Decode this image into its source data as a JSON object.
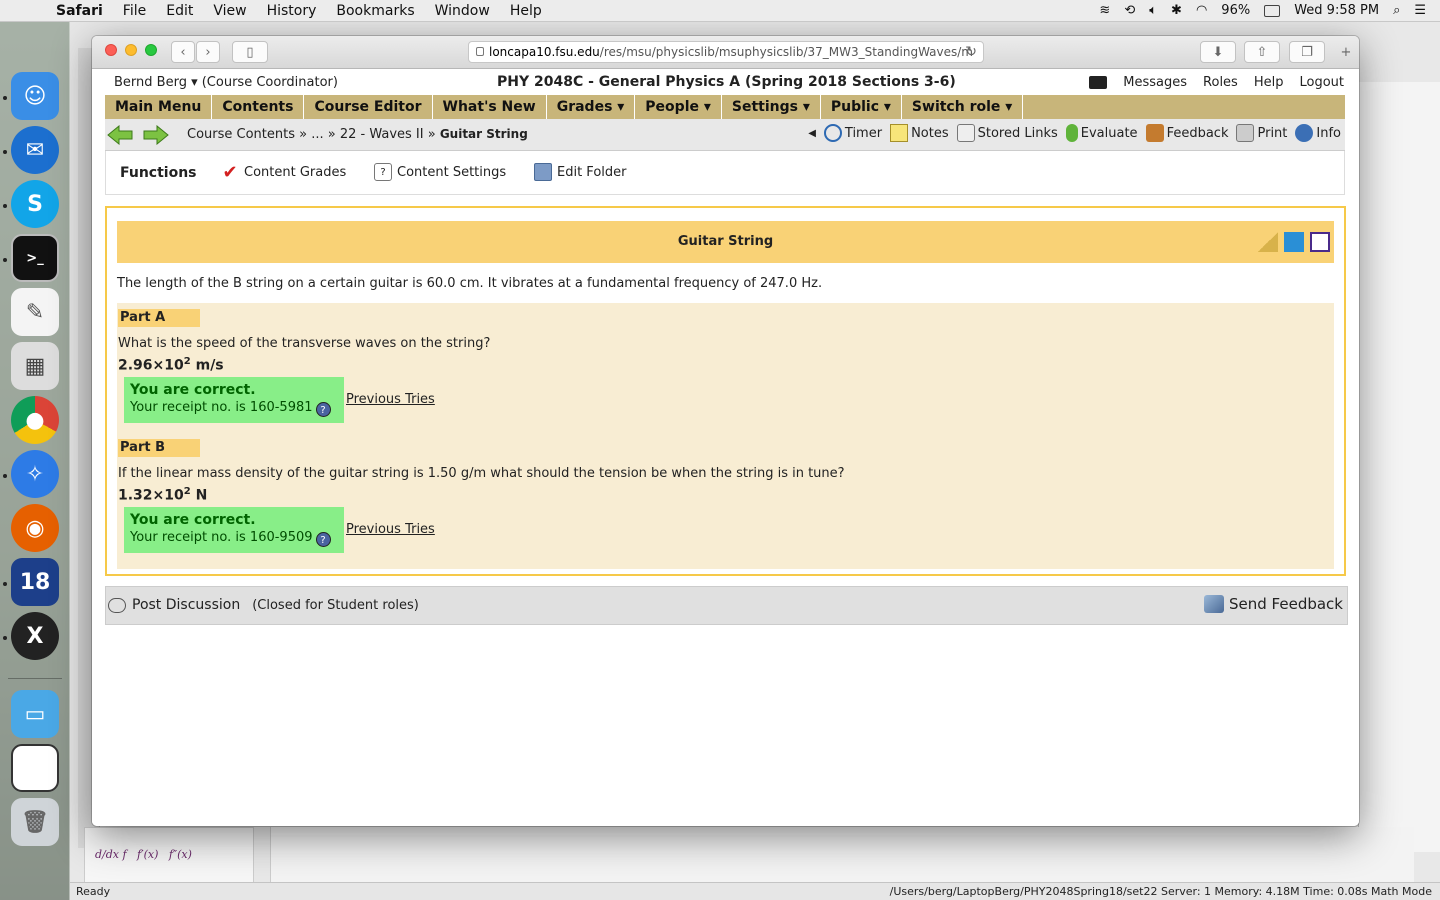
{
  "menubar": {
    "app": "Safari",
    "items": [
      "File",
      "Edit",
      "View",
      "History",
      "Bookmarks",
      "Window",
      "Help"
    ],
    "battery": "96%",
    "clock": "Wed 9:58 PM"
  },
  "browser": {
    "url_host": "loncapa10.fsu.edu",
    "url_path": "/res/msu/physicslib/msuphysicslib/37_MW3_StandingWaves/m"
  },
  "header": {
    "user": "Bernd Berg ▾ (Course Coordinator)",
    "course": "PHY 2048C - General Physics A (Spring 2018 Sections 3-6)",
    "links": [
      "Messages",
      "Roles",
      "Help",
      "Logout"
    ]
  },
  "main_menu": [
    "Main Menu",
    "Contents",
    "Course Editor",
    "What's New",
    "Grades ▾",
    "People ▾",
    "Settings ▾",
    "Public ▾",
    "Switch role ▾"
  ],
  "nav": {
    "crumbs": "Course Contents » ... » 22 - Waves II »",
    "current": "Guitar String",
    "tools": [
      "Timer",
      "Notes",
      "Stored Links",
      "Evaluate",
      "Feedback",
      "Print",
      "Info"
    ]
  },
  "functions": {
    "title": "Functions",
    "items": [
      "Content Grades",
      "Content Settings",
      "Edit Folder"
    ]
  },
  "problem": {
    "title": "Guitar String",
    "intro": "The length of the B string on a certain guitar is 60.0 cm. It vibrates at a fundamental frequency of 247.0 Hz.",
    "parts": [
      {
        "label": "Part A",
        "question": "What is the speed of the transverse waves on the string?",
        "answer_mantissa": "2.96×10",
        "answer_exp": "2",
        "answer_unit": " m/s",
        "status": "You are correct.",
        "receipt": "Your receipt no. is 160-5981",
        "prev": "Previous Tries"
      },
      {
        "label": "Part B",
        "question": "If the linear mass density of the guitar string is 1.50 g/m what should the tension be when the string is in tune?",
        "answer_mantissa": "1.32×10",
        "answer_exp": "2",
        "answer_unit": " N",
        "status": "You are correct.",
        "receipt": "Your receipt no. is 160-9509",
        "prev": "Previous Tries"
      }
    ]
  },
  "discussion": {
    "post": "Post Discussion",
    "note": "(Closed for Student roles)",
    "send": "Send Feedback"
  },
  "statusbar": {
    "left": "Ready",
    "right": "/Users/berg/LaptopBerg/PHY2048Spring18/set22   Server: 1   Memory: 4.18M   Time: 0.08s   Math Mode"
  }
}
